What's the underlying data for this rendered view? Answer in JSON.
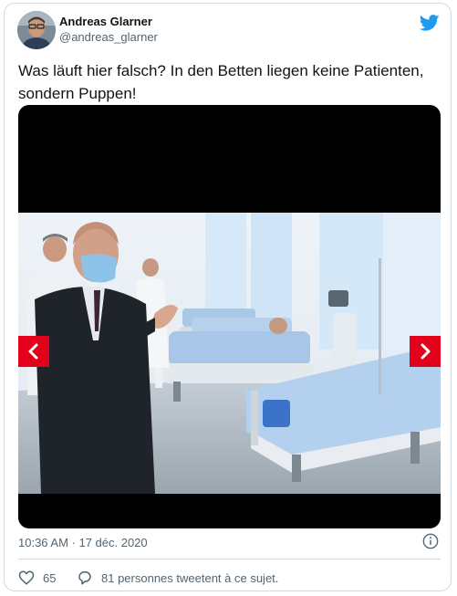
{
  "tweet": {
    "author_name": "Andreas Glarner",
    "author_handle": "@andreas_glarner",
    "text": "Was läuft hier falsch? In den Betten liegen keine Patienten, sondern Puppen!",
    "timestamp": "10:36 AM · 17 déc. 2020",
    "like_count": "65",
    "conversation_text": "81 personnes tweetent à ce sujet."
  },
  "media": {
    "prev_icon": "chevron-left-icon",
    "next_icon": "chevron-right-icon"
  },
  "colors": {
    "twitter_blue": "#1d9bf0",
    "nav_red": "#e2001a",
    "muted_text": "#536471",
    "border": "#cfd9de"
  },
  "icons": [
    "twitter-bird-icon",
    "info-icon",
    "heart-icon",
    "comment-icon"
  ]
}
